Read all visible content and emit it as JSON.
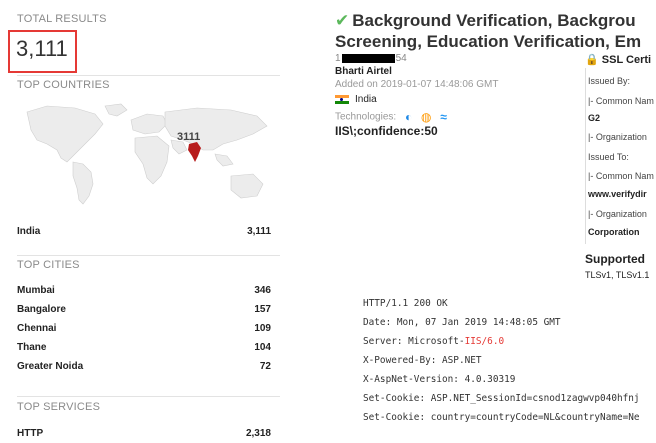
{
  "sidebar": {
    "total_results": {
      "title": "TOTAL RESULTS",
      "value": "3,111"
    },
    "top_countries": {
      "title": "TOP COUNTRIES",
      "map_count": "3111",
      "items": [
        {
          "label": "India",
          "value": "3,111"
        }
      ]
    },
    "top_cities": {
      "title": "TOP CITIES",
      "items": [
        {
          "label": "Mumbai",
          "value": "346"
        },
        {
          "label": "Bangalore",
          "value": "157"
        },
        {
          "label": "Chennai",
          "value": "109"
        },
        {
          "label": "Thane",
          "value": "104"
        },
        {
          "label": "Greater Noida",
          "value": "72"
        }
      ]
    },
    "top_services": {
      "title": "TOP SERVICES",
      "items": [
        {
          "label": "HTTP",
          "value": "2,318"
        }
      ]
    }
  },
  "result": {
    "title_line1": "Background Verification, Backgrou",
    "title_line2": "Screening, Education Verification, Em",
    "ip_prefix": "1",
    "ip_suffix": "54",
    "org": "Bharti Airtel",
    "added": "Added on 2019-01-07 14:48:06 GMT",
    "country": "India",
    "technologies_label": "Technologies:",
    "tech_icons": [
      "jquery-icon",
      "bootstrap-icon",
      "aspnet-icon"
    ],
    "iis_line": "IIS\\;confidence:50",
    "ssl": {
      "header": "SSL Certi",
      "issued_by": "Issued By:",
      "issued_by_cn": "|- Common Nam",
      "issued_by_cn_val": "G2",
      "issued_by_org": "|- Organization",
      "issued_to": "Issued To:",
      "issued_to_cn": "|- Common Nam",
      "issued_to_cn_val": "www.verifydir",
      "issued_to_org": "|- Organization",
      "issued_to_org_val": "Corporation",
      "supported": "Supported",
      "tls": "TLSv1, TLSv1.1"
    },
    "banner": {
      "status": "HTTP/1.1 200 OK",
      "date": "Date: Mon, 07 Jan 2019 14:48:05 GMT",
      "server_prefix": "Server: Microsoft-",
      "server_highlight": "IIS/6.0",
      "powered": "X-Powered-By: ASP.NET",
      "aspnet": "X-AspNet-Version: 4.0.30319",
      "cookie1": "Set-Cookie: ASP.NET_SessionId=csnod1zagwvp040hfnj",
      "cookie2": "Set-Cookie: country=countryCode=NL&countryName=Ne"
    }
  }
}
